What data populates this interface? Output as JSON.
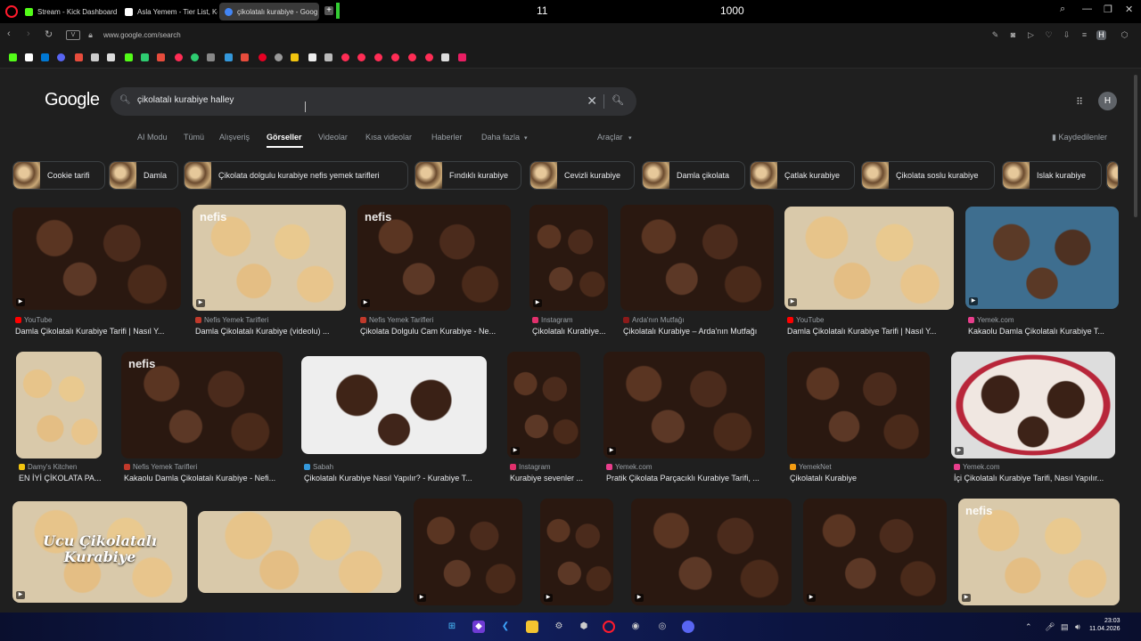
{
  "browser": {
    "tabs": [
      {
        "label": "Stream - Kick Dashboard",
        "color": "#53fc18"
      },
      {
        "label": "Asla Yemem - Tier List, Ko",
        "color": "#ffffff"
      },
      {
        "label": "çikolatalı kurabiye - Goog",
        "color": "#4285f4",
        "active": true
      }
    ],
    "overlay_left": "11",
    "overlay_right": "1000",
    "url": "www.google.com/search"
  },
  "google": {
    "logo": "Google",
    "query": "çikolatalı kurabiye halley",
    "avatar": "H",
    "tabs": [
      "AI Modu",
      "Tümü",
      "Alışveriş",
      "Görseller",
      "Videolar",
      "Kısa videolar",
      "Haberler",
      "Daha fazla",
      "Araçlar"
    ],
    "saved": "Kaydedilenler",
    "chips": [
      "Cookie tarifi",
      "Damla",
      "Çikolata dolgulu kurabiye nefis yemek tarifleri",
      "Fındıklı kurabiye",
      "Cevizli kurabiye",
      "Damla çikolata",
      "Çatlak kurabiye",
      "Çikolata soslu kurabiye",
      "Islak kurabiye"
    ]
  },
  "results": [
    {
      "source": "YouTube",
      "title": "Damla Çikolatalı Kurabiye Tarifi | Nasıl Y...",
      "src_color": "#ff0000",
      "style": "dark",
      "play": true
    },
    {
      "source": "Nefis Yemek Tarifleri",
      "title": "Damla Çikolatalı Kurabiye (videolu) ...",
      "src_color": "#c0392b",
      "style": "light",
      "wm": "nefis",
      "play": true
    },
    {
      "source": "Nefis Yemek Tarifleri",
      "title": "Çikolata Dolgulu Cam Kurabiye - Ne...",
      "src_color": "#c0392b",
      "style": "dark",
      "wm": "nefis",
      "play": true
    },
    {
      "source": "Instagram",
      "title": "Çikolatalı Kurabiye...",
      "src_color": "#e1306c",
      "style": "dark",
      "play": true
    },
    {
      "source": "Arda'nın Mutfağı",
      "title": "Çikolatalı Kurabiye – Arda'nın Mutfağı",
      "src_color": "#8b1a1a",
      "style": "dark"
    },
    {
      "source": "YouTube",
      "title": "Damla Çikolatalı Kurabiye Tarifi | Nasıl Y...",
      "src_color": "#ff0000",
      "style": "light",
      "play": true
    },
    {
      "source": "Yemek.com",
      "title": "Kakaolu Damla Çikolatalı Kurabiye T...",
      "src_color": "#e83e8c",
      "style": "blue",
      "play": true
    },
    {
      "source": "Damy's Kitchen",
      "title": "EN İYİ ÇİKOLATA PA...",
      "src_color": "#f1c40f",
      "style": "light"
    },
    {
      "source": "Nefis Yemek Tarifleri",
      "title": "Kakaolu Damla Çikolatalı Kurabiye - Nefi...",
      "src_color": "#c0392b",
      "style": "dark",
      "wm": "nefis"
    },
    {
      "source": "Sabah",
      "title": "Çikolatalı Kurabiye Nasıl Yapılır? - Kurabiye T...",
      "src_color": "#3498db",
      "style": "trans"
    },
    {
      "source": "Instagram",
      "title": "Kurabiye sevenler ...",
      "src_color": "#e1306c",
      "style": "dark",
      "play": true
    },
    {
      "source": "Yemek.com",
      "title": "Pratik Çikolata Parçacıklı Kurabiye Tarifi, ...",
      "src_color": "#e83e8c",
      "style": "dark",
      "play": true
    },
    {
      "source": "YemekNet",
      "title": "Çikolatalı Kurabiye",
      "src_color": "#f39c12",
      "style": "dark"
    },
    {
      "source": "Yemek.com",
      "title": "İçi Çikolatalı Kurabiye Tarifi, Nasıl Yapılır...",
      "src_color": "#e83e8c",
      "style": "plate",
      "play": true
    },
    {
      "source": "",
      "title": "",
      "style": "light",
      "bigtxt": "Ucu Çikolatalı Kurabiye",
      "play": true
    },
    {
      "source": "",
      "title": "",
      "style": "light"
    },
    {
      "source": "",
      "title": "",
      "style": "dark",
      "play": true
    },
    {
      "source": "",
      "title": "",
      "style": "dark",
      "play": true
    },
    {
      "source": "",
      "title": "",
      "style": "dark",
      "play": true
    },
    {
      "source": "",
      "title": "",
      "style": "dark",
      "play": true
    },
    {
      "source": "",
      "title": "",
      "style": "light",
      "wm": "nefis",
      "play": true
    }
  ],
  "taskbar": {
    "time": "23:03",
    "date": "11.04.2026"
  }
}
